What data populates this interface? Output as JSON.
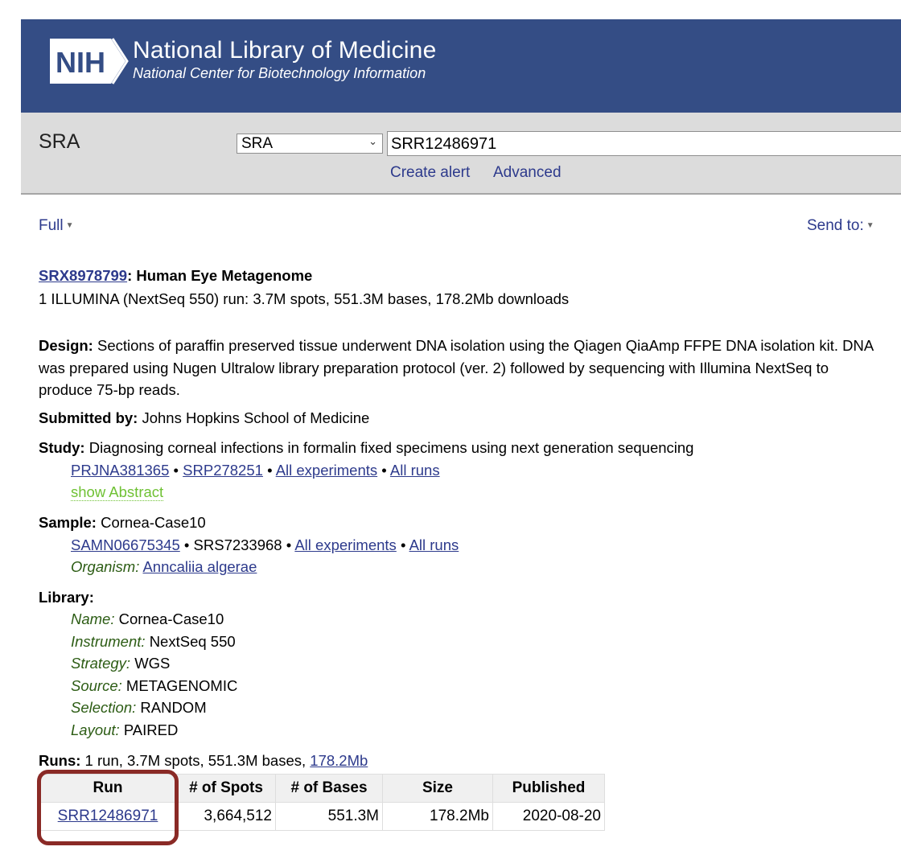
{
  "header": {
    "logo_text": "NIH",
    "title": "National Library of Medicine",
    "subtitle": "National Center for Biotechnology Information"
  },
  "search": {
    "db_title": "SRA",
    "db_select": "SRA",
    "query": "SRR12486971",
    "create_alert": "Create alert",
    "advanced": "Advanced"
  },
  "toolbar": {
    "format": "Full",
    "send_to": "Send to:"
  },
  "record": {
    "accession": "SRX8978799",
    "title": ": Human Eye Metagenome",
    "summary": "1 ILLUMINA (NextSeq 550) run: 3.7M spots, 551.3M bases, 178.2Mb downloads",
    "design_label": "Design:",
    "design_text": "Sections of paraffin preserved tissue underwent DNA isolation using the Qiagen QiaAmp FFPE DNA isolation kit. DNA was prepared using Nugen Ultralow library preparation protocol (ver. 2) followed by sequencing with Illumina NextSeq to produce 75-bp reads.",
    "submitted_label": "Submitted by:",
    "submitted_by": "Johns Hopkins School of Medicine",
    "study_label": "Study:",
    "study_title": "Diagnosing corneal infections in formalin fixed specimens using next generation sequencing",
    "study_links": [
      "PRJNA381365",
      "SRP278251",
      "All experiments",
      "All runs"
    ],
    "show_abstract": "show Abstract",
    "sample_label": "Sample:",
    "sample_name": "Cornea-Case10",
    "sample_accession": "SAMN06675345",
    "sample_srs": "SRS7233968",
    "sample_links": [
      "All experiments",
      "All runs"
    ],
    "organism_label": "Organism:",
    "organism": "Anncaliia algerae",
    "library_label": "Library:",
    "library": [
      {
        "label": "Name:",
        "value": "Cornea-Case10"
      },
      {
        "label": "Instrument:",
        "value": "NextSeq 550"
      },
      {
        "label": "Strategy:",
        "value": "WGS"
      },
      {
        "label": "Source:",
        "value": "METAGENOMIC"
      },
      {
        "label": "Selection:",
        "value": "RANDOM"
      },
      {
        "label": "Layout:",
        "value": "PAIRED"
      }
    ],
    "runs_label": "Runs:",
    "runs_summary": " 1 run, 3.7M spots, 551.3M bases, ",
    "runs_download": "178.2Mb",
    "bullet": "•"
  },
  "runs_table": {
    "headers": [
      "Run",
      "# of Spots",
      "# of Bases",
      "Size",
      "Published"
    ],
    "rows": [
      [
        "SRR12486971",
        "3,664,512",
        "551.3M",
        "178.2Mb",
        "2020-08-20"
      ]
    ]
  },
  "colors": {
    "header_bg": "#344d85",
    "link": "#2d3a8c",
    "highlight": "#8a2a26",
    "abstract_link": "#6fc134"
  }
}
